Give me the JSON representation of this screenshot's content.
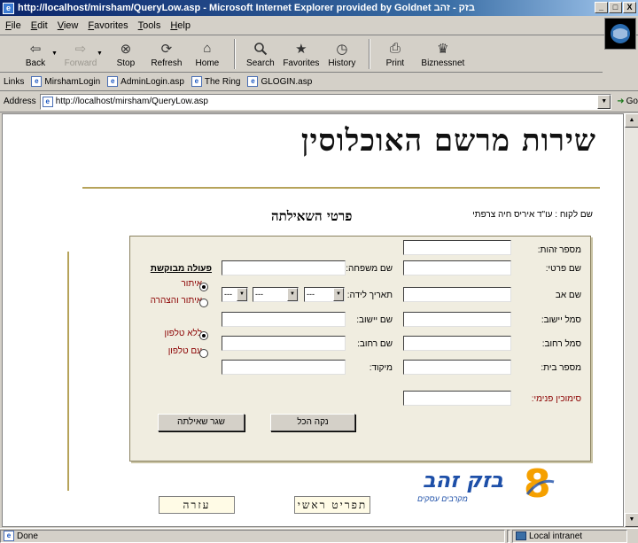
{
  "window": {
    "title": "http://localhost/mirsham/QueryLow.asp - Microsoft Internet Explorer provided by Goldnet בזק - זהב",
    "buttons": {
      "minimize": "_",
      "maximize": "□",
      "close": "X"
    }
  },
  "menu": [
    "File",
    "Edit",
    "View",
    "Favorites",
    "Tools",
    "Help"
  ],
  "toolbar": [
    {
      "label": "Back",
      "icon": "back-arrow-icon",
      "glyph": "⇦",
      "disabled": false
    },
    {
      "label": "Forward",
      "icon": "forward-arrow-icon",
      "glyph": "⇨",
      "disabled": true
    },
    {
      "label": "Stop",
      "icon": "stop-icon",
      "glyph": "⊗",
      "disabled": false
    },
    {
      "label": "Refresh",
      "icon": "refresh-icon",
      "glyph": "⟳",
      "disabled": false
    },
    {
      "label": "Home",
      "icon": "home-icon",
      "glyph": "⌂",
      "disabled": false
    },
    {
      "label": "Search",
      "icon": "search-icon",
      "glyph": "🔍",
      "disabled": false
    },
    {
      "label": "Favorites",
      "icon": "favorites-icon",
      "glyph": "★",
      "disabled": false
    },
    {
      "label": "History",
      "icon": "history-icon",
      "glyph": "◷",
      "disabled": false
    },
    {
      "label": "Print",
      "icon": "print-icon",
      "glyph": "⎙",
      "disabled": false
    },
    {
      "label": "Biznessnet",
      "icon": "biznessnet-icon",
      "glyph": "♛",
      "disabled": false
    }
  ],
  "links": {
    "label": "Links",
    "items": [
      "MirshamLogin",
      "AdminLogin.asp",
      "The Ring",
      "GLOGIN.asp"
    ]
  },
  "address": {
    "label": "Address",
    "url": "http://localhost/mirsham/QueryLow.asp",
    "go": "Go"
  },
  "page": {
    "title": "שירות מרשם האוכלוסין",
    "heading": "פרטי השאילתה",
    "customer": "שם לקוח : עו\"ד איריס חיה צרפתי",
    "form": {
      "id_number": "מספר זהות:",
      "first_name": "שם פרטי:",
      "father_name": "שם אב",
      "settlement_code": "סמל יישוב:",
      "street_code": "סמל רחוב:",
      "house_number": "מספר בית:",
      "reference": "סימוכין פנימי:",
      "last_name": "שם משפחה:",
      "birth_date": "תאריך לידה:",
      "settlement_name": "שם יישוב:",
      "street_name": "שם רחוב:",
      "zip": "מיקוד:",
      "date_placeholder": "---",
      "action_title": "פעולה מבוקשת",
      "radios": {
        "verify": "איתור",
        "verify_declare": "איתור והצהרה",
        "no_phone": "ללא טלפון",
        "with_phone": "עם טלפון"
      },
      "clear_button": "נקה הכל",
      "submit_button": "שגר שאילתה"
    },
    "help_button": "עזרה",
    "main_menu_button": "תפריט ראשי",
    "logo": {
      "brand": "בזק זהב",
      "tagline": "מקרבים עסקים",
      "number": "8"
    }
  },
  "status": {
    "text": "Done",
    "zone": "Local intranet"
  },
  "colors": {
    "titlebar": "#0a246a",
    "rule": "#b6a35a",
    "form_bg": "#f0ede0",
    "label_red": "#8b0000",
    "logo_blue": "#1d4fa8",
    "logo_orange": "#f5a000"
  }
}
